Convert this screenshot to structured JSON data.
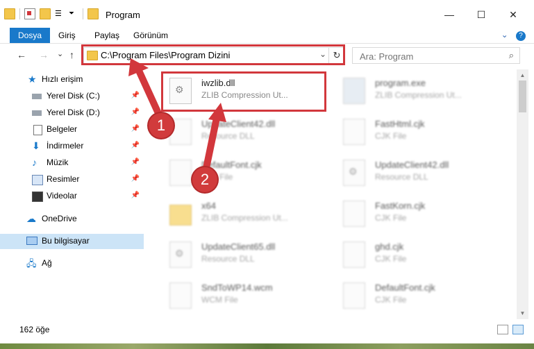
{
  "window": {
    "title": "Program",
    "controls": {
      "minimize": "—",
      "maximize": "☐",
      "close": "✕"
    }
  },
  "ribbon": {
    "tabs": [
      {
        "label": "Dosya",
        "active": true
      },
      {
        "label": "Giriş"
      },
      {
        "label": "Paylaş"
      },
      {
        "label": "Görünüm"
      }
    ],
    "help": "?"
  },
  "nav": {
    "back": "←",
    "forward": "→",
    "recent": "⌄",
    "up": "↑",
    "address_path": "C:\\Program Files\\Program Dizini",
    "dropdown": "⌄",
    "refresh": "↻"
  },
  "search": {
    "placeholder": "Ara: Program",
    "icon": "⌕"
  },
  "sidebar": {
    "items": [
      {
        "label": "Hızlı erişim",
        "icon": "star-icon",
        "pinned": false,
        "color": "#1979ca"
      },
      {
        "label": "Yerel Disk (C:)",
        "icon": "drive-icon",
        "pinned": true
      },
      {
        "label": "Yerel Disk (D:)",
        "icon": "drive-icon",
        "pinned": true
      },
      {
        "label": "Belgeler",
        "icon": "documents-icon",
        "pinned": true
      },
      {
        "label": "İndirmeler",
        "icon": "download-icon",
        "pinned": true
      },
      {
        "label": "Müzik",
        "icon": "music-icon",
        "pinned": true
      },
      {
        "label": "Resimler",
        "icon": "pictures-icon",
        "pinned": true
      },
      {
        "label": "Videolar",
        "icon": "videos-icon",
        "pinned": true
      },
      {
        "label": "OneDrive",
        "icon": "cloud-icon",
        "pinned": false
      },
      {
        "label": "Bu bilgisayar",
        "icon": "computer-icon",
        "pinned": false,
        "selected": true
      },
      {
        "label": "Ağ",
        "icon": "network-icon",
        "pinned": false
      }
    ],
    "pin_glyph": "📌"
  },
  "files": [
    {
      "name": "iwzlib.dll",
      "type": "ZLIB Compression Ut...",
      "icon": "gear",
      "highlight": true
    },
    {
      "name": "program.exe",
      "type": "ZLIB Compression Ut...",
      "icon": "app"
    },
    {
      "name": "UpdateClient42.dll",
      "type": "Resource DLL",
      "icon": "page"
    },
    {
      "name": "FastHtml.cjk",
      "type": "CJK File",
      "icon": "page"
    },
    {
      "name": "DefaultFont.cjk",
      "type": "CJK File",
      "icon": "page"
    },
    {
      "name": "UpdateClient42.dll",
      "type": "Resource DLL",
      "icon": "gear"
    },
    {
      "name": "x64",
      "type": "ZLIB Compression Ut...",
      "icon": "folder"
    },
    {
      "name": "FastKorn.cjk",
      "type": "CJK File",
      "icon": "page"
    },
    {
      "name": "UpdateClient65.dll",
      "type": "Resource DLL",
      "icon": "gear"
    },
    {
      "name": "ghd.cjk",
      "type": "CJK File",
      "icon": "page"
    },
    {
      "name": "SndToWP14.wcm",
      "type": "WCM File",
      "icon": "page"
    },
    {
      "name": "DefaultFont.cjk",
      "type": "CJK File",
      "icon": "page"
    }
  ],
  "status": {
    "count": "162 öğe"
  },
  "annotations": {
    "callout1": "1",
    "callout2": "2",
    "color": "#d2373c"
  }
}
